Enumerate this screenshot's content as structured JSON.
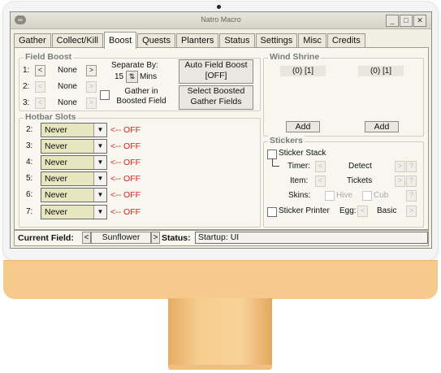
{
  "window": {
    "title": "Natro Macro",
    "minimize": "_",
    "maximize": "□",
    "close": "✕",
    "app_icon": "∞"
  },
  "tabs": [
    "Gather",
    "Collect/Kill",
    "Boost",
    "Quests",
    "Planters",
    "Status",
    "Settings",
    "Misc",
    "Credits"
  ],
  "active_tab": "Boost",
  "field_boost": {
    "title": "Field Boost",
    "rows": [
      {
        "label": "1:",
        "left": "<",
        "value": "None",
        "right": ">"
      },
      {
        "label": "2:",
        "left": "<",
        "value": "None",
        "right": ">"
      },
      {
        "label": "3:",
        "left": "<",
        "value": "None",
        "right": ">"
      }
    ],
    "separate_label": "Separate By:",
    "separate_value": "15",
    "mins_label": "Mins",
    "auto_boost_button": [
      "Auto Field Boost",
      "[OFF]"
    ],
    "gather_label": [
      "Gather in",
      "Boosted Field"
    ],
    "select_fields_button": [
      "Select Boosted",
      "Gather Fields"
    ]
  },
  "hotbar": {
    "title": "Hotbar Slots",
    "rows": [
      {
        "label": "2:",
        "value": "Never",
        "status": "<-- OFF"
      },
      {
        "label": "3:",
        "value": "Never",
        "status": "<-- OFF"
      },
      {
        "label": "4:",
        "value": "Never",
        "status": "<-- OFF"
      },
      {
        "label": "5:",
        "value": "Never",
        "status": "<-- OFF"
      },
      {
        "label": "6:",
        "value": "Never",
        "status": "<-- OFF"
      },
      {
        "label": "7:",
        "value": "Never",
        "status": "<-- OFF"
      }
    ]
  },
  "wind_shrine": {
    "title": "Wind Shrine",
    "left_value": "(0) [1]",
    "right_value": "(0) [1]",
    "add_left": "Add",
    "add_right": "Add"
  },
  "stickers": {
    "title": "Stickers",
    "stack_label": "Sticker Stack",
    "timer_label": "Timer:",
    "detect_label": "Detect",
    "item_label": "Item:",
    "tickets_label": "Tickets",
    "skins_label": "Skins:",
    "hive_label": "Hive",
    "cub_label": "Cub",
    "printer_label": "Sticker Printer",
    "egg_label": "Egg:",
    "basic_label": "Basic",
    "question": "?",
    "left_arrow": "<",
    "right_arrow": ">"
  },
  "statusbar": {
    "current_field_label": "Current Field:",
    "left": "<",
    "field": "Sunflower",
    "right": ">",
    "status_label": "Status:",
    "status": "Startup: UI"
  },
  "stepper_glyph": "⇅",
  "dropdown_glyph": "▼"
}
